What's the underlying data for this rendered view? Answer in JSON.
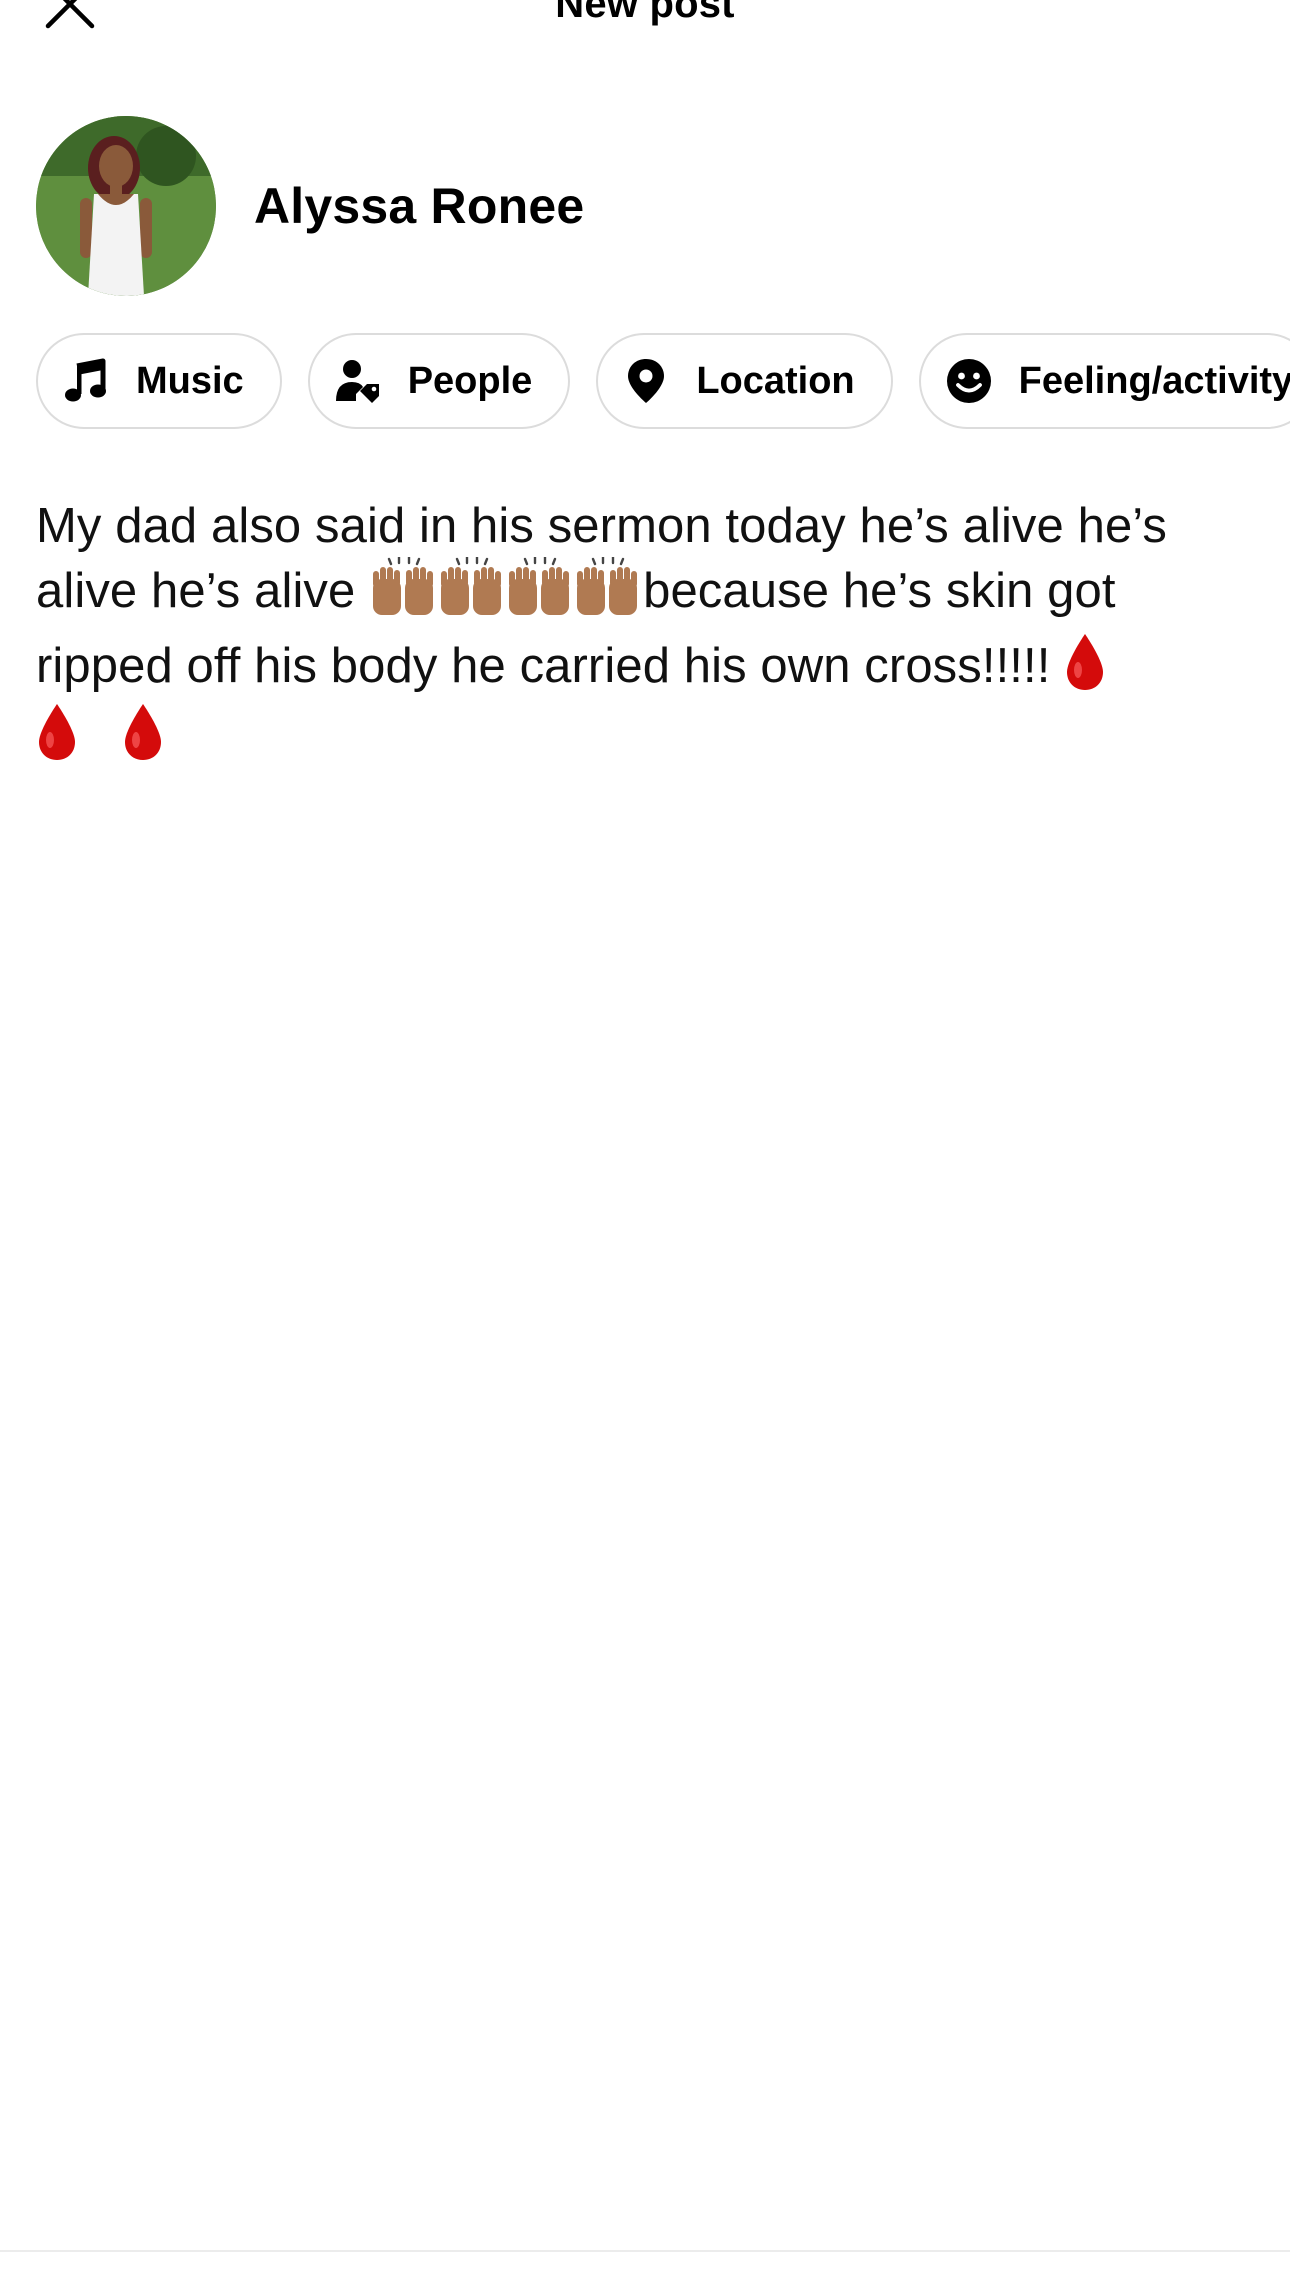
{
  "header": {
    "title": "New post",
    "close_icon": "close-icon"
  },
  "profile": {
    "name": "Alyssa Ronee",
    "avatar": "profile-photo"
  },
  "chips": [
    {
      "label": "Music",
      "icon": "music-note-icon"
    },
    {
      "label": "People",
      "icon": "tag-people-icon"
    },
    {
      "label": "Location",
      "icon": "location-pin-icon"
    },
    {
      "label": "Feeling/activity",
      "icon": "smiley-face-icon"
    }
  ],
  "post": {
    "line1": "My dad also said in his sermon today he’s alive he’s",
    "line2_prefix": "alive he’s alive ",
    "praise_hands_count": 4,
    "line2_suffix": "because he’s skin got",
    "line3": "ripped off his body he carried his own cross!!!!! ",
    "drop_emoji": "blood-drop",
    "drop_color": "#d40b0b"
  },
  "colors": {
    "chip_border": "#dcdcdc",
    "text": "#111111",
    "skin_tone": "#b07a52"
  }
}
